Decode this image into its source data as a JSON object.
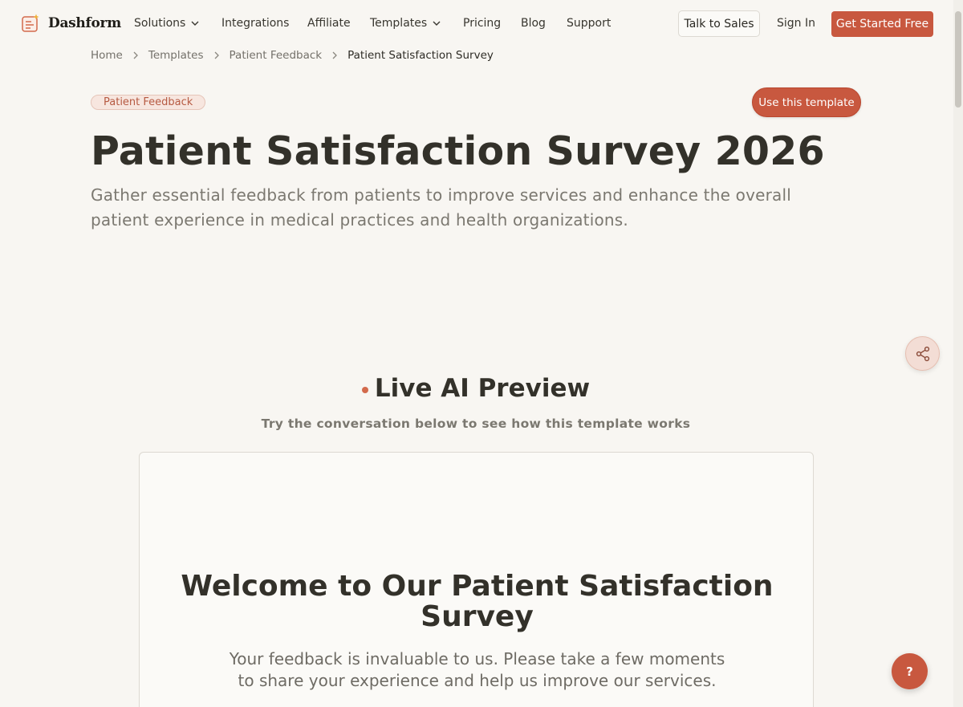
{
  "brand": {
    "name": "Dashform",
    "logo_icon": "form-sparkle-icon"
  },
  "nav": {
    "items": [
      {
        "label": "Solutions",
        "has_dropdown": true
      },
      {
        "label": "Integrations",
        "has_dropdown": false
      },
      {
        "label": "Affiliate",
        "has_dropdown": false
      },
      {
        "label": "Templates",
        "has_dropdown": true
      },
      {
        "label": "Pricing",
        "has_dropdown": false
      },
      {
        "label": "Blog",
        "has_dropdown": false
      },
      {
        "label": "Support",
        "has_dropdown": false
      }
    ],
    "talk_to_sales": "Talk to Sales",
    "sign_in": "Sign In",
    "get_started": "Get Started Free"
  },
  "breadcrumb": [
    "Home",
    "Templates",
    "Patient Feedback",
    "Patient Satisfaction Survey"
  ],
  "hero": {
    "tag": "Patient Feedback",
    "use_template": "Use this template",
    "title": "Patient Satisfaction Survey 2026",
    "subtitle": "Gather essential feedback from patients to improve services and enhance the overall patient experience in medical practices and health organizations."
  },
  "preview": {
    "title": "Live AI Preview",
    "subtitle": "Try the conversation below to see how this template works",
    "welcome_title": "Welcome to Our Patient Satisfaction Survey",
    "welcome_text": "Your feedback is invaluable to us. Please take a few moments to share your experience and help us improve our services."
  },
  "floating": {
    "help_label": "?",
    "share_icon": "share-icon"
  },
  "colors": {
    "accent": "#c8583f",
    "background": "#f8f6f2",
    "text": "#33312a",
    "muted": "#7b7870"
  }
}
